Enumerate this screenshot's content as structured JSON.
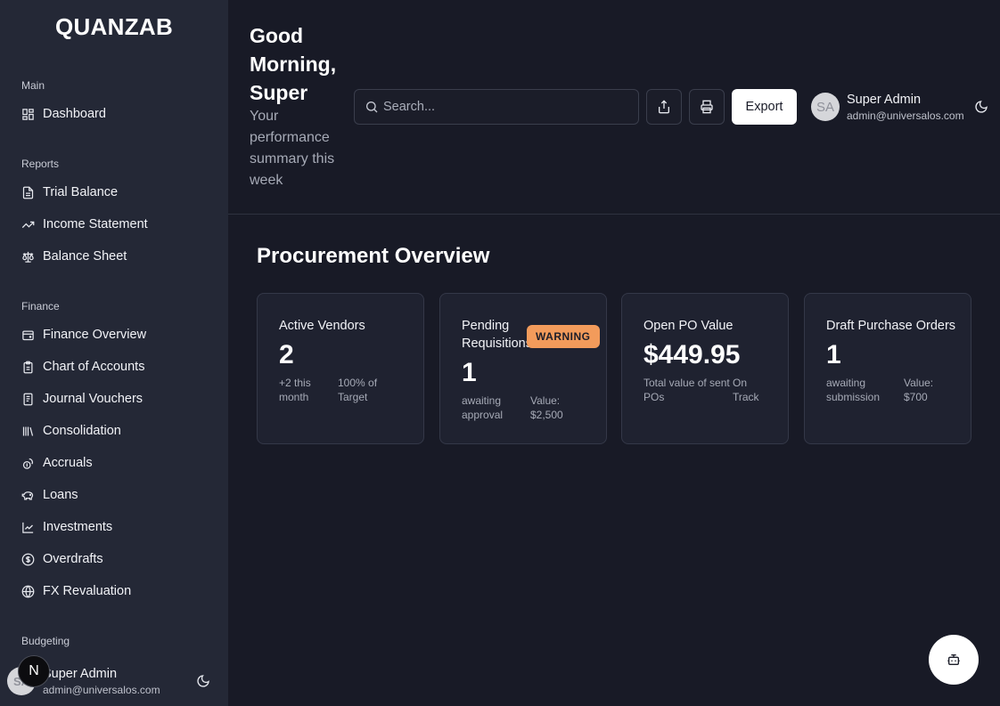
{
  "brand": "QUANZAB",
  "sidebar": {
    "sections": [
      {
        "label": "Main",
        "items": [
          {
            "label": "Dashboard",
            "icon": "dashboard-icon"
          }
        ]
      },
      {
        "label": "Reports",
        "items": [
          {
            "label": "Trial Balance",
            "icon": "document-icon"
          },
          {
            "label": "Income Statement",
            "icon": "trending-up-icon"
          },
          {
            "label": "Balance Sheet",
            "icon": "scale-icon"
          }
        ]
      },
      {
        "label": "Finance",
        "items": [
          {
            "label": "Finance Overview",
            "icon": "wallet-icon"
          },
          {
            "label": "Chart of Accounts",
            "icon": "clipboard-icon"
          },
          {
            "label": "Journal Vouchers",
            "icon": "receipt-icon"
          },
          {
            "label": "Consolidation",
            "icon": "library-icon"
          },
          {
            "label": "Accruals",
            "icon": "coins-icon"
          },
          {
            "label": "Loans",
            "icon": "piggy-bank-icon"
          },
          {
            "label": "Investments",
            "icon": "line-chart-icon"
          },
          {
            "label": "Overdrafts",
            "icon": "dollar-circle-icon"
          },
          {
            "label": "FX Revaluation",
            "icon": "globe-icon"
          }
        ]
      },
      {
        "label": "Budgeting",
        "items": []
      }
    ],
    "user": {
      "initials": "SA",
      "name": "Super Admin",
      "email": "admin@universalos.com"
    }
  },
  "badge_letter": "N",
  "header": {
    "greeting": "Good Morning, Super",
    "subtitle": "Your performance summary this week",
    "search_placeholder": "Search...",
    "export_label": "Export",
    "user": {
      "initials": "SA",
      "name": "Super Admin",
      "email": "admin@universalos.com"
    }
  },
  "overview": {
    "title": "Procurement Overview",
    "cards": [
      {
        "title": "Active Vendors",
        "value": "2",
        "sub_left": "+2 this month",
        "sub_right": "100% of Target"
      },
      {
        "title": "Pending Requisitions",
        "badge": "WARNING",
        "value": "1",
        "sub_left": "awaiting approval",
        "sub_right": "Value: $2,500"
      },
      {
        "title": "Open PO Value",
        "value": "$449.95",
        "sub_left": "Total value of sent POs",
        "sub_right": "On Track"
      },
      {
        "title": "Draft Purchase Orders",
        "value": "1",
        "sub_left": "awaiting submission",
        "sub_right": "Value: $700"
      }
    ]
  },
  "colors": {
    "background": "#181a26",
    "sidebar": "#242836",
    "card": "#1f2230",
    "warning": "#f29b5b"
  }
}
